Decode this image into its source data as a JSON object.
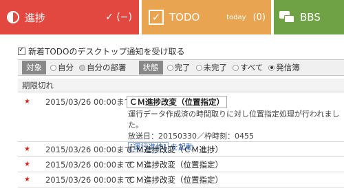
{
  "tabs": {
    "progress": {
      "label": "進捗",
      "count": "✓ (−)"
    },
    "todo": {
      "label": "TODO",
      "today": "today",
      "count": "(0)"
    },
    "bbs": {
      "label": "BBS"
    }
  },
  "colors": {
    "progress": "#e2483f",
    "todo": "#e9a451",
    "bbs": "#6fa245",
    "star": "#d6261d"
  },
  "notify": {
    "label": "新着TODOのデスクトップ通知を受け取る",
    "checked": true
  },
  "filter": {
    "target_label": "対象",
    "target_options": [
      "自分",
      "自分の部署"
    ],
    "target_selected": "自分の部署",
    "status_label": "状態",
    "status_options": [
      "完了",
      "未完了",
      "すべて",
      "発信簿"
    ],
    "status_selected": "発信簿"
  },
  "section": {
    "title": "期限切れ"
  },
  "items": [
    {
      "date": "2015/03/26 00:00まで",
      "title": "ＣＭ進捗改変（位置指定）",
      "detail_line1": "運行データ作成済の時間取りに対し位置指定処理が行われました。",
      "detail_line2": "放送日：20150330／枠時刻：0455",
      "link_label": "[運行進捗]",
      "link_suffix": "を起動"
    },
    {
      "date": "2015/03/26 00:00まで",
      "title": "ＣＭ進捗改変（ＣＭ進捗）"
    },
    {
      "date": "2015/03/26 00:00まで",
      "title": "ＣＭ進捗改変（位置指定）"
    },
    {
      "date": "2015/03/26 00:00まで",
      "title": "ＣＭ進捗改変（位置指定）"
    }
  ]
}
